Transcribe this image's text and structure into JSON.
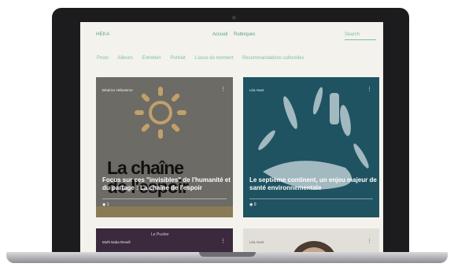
{
  "header": {
    "brand": "HEKA",
    "nav": [
      "Accueil",
      "Rubriques"
    ],
    "search_placeholder": "Search"
  },
  "categories": [
    "Posts",
    "Ailleurs",
    "Entretien",
    "Portrait",
    "L'asso du moment",
    "Recommandations culturelles"
  ],
  "cards": [
    {
      "author": "Béatrice Hébuterne",
      "title_line1": "Focus sur ces \"invisibles\" de l'humanité et",
      "title_line2": "du partage : La chaîne de l'espoir",
      "views": "1",
      "image_text_line1": "La chaîne",
      "image_text_line2": "de l'espoir"
    },
    {
      "author": "Léa Huet",
      "title_line1": "Le septième continent, un enjeu majeur de",
      "title_line2": "santé environnementale",
      "views": "0"
    },
    {
      "author": "Mufti Naba Revell",
      "image_caption": "Le Pusher"
    },
    {
      "author": "Léa Huet"
    }
  ],
  "colors": {
    "accent": "#5aa08a",
    "screen_bg": "#f3f2ec",
    "frame": "#1c1c1e"
  }
}
